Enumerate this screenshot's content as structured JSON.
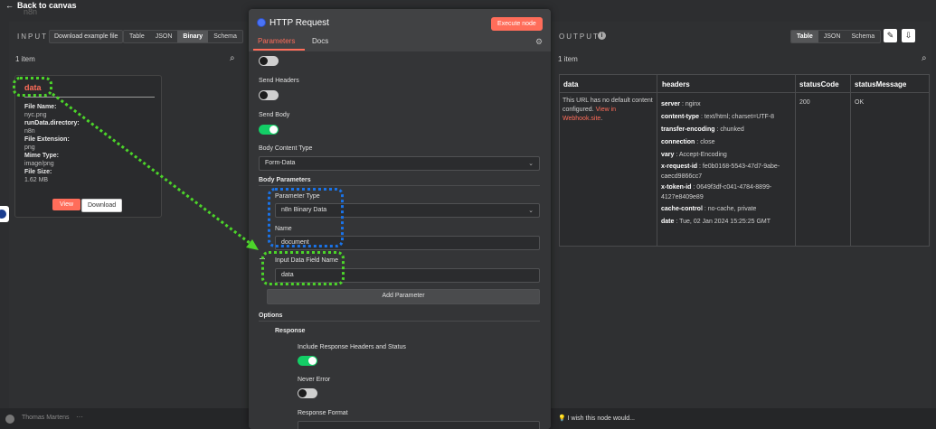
{
  "topbar": {
    "back_label": "Back to canvas",
    "subtitle": "n8n"
  },
  "input_panel": {
    "title": "INPUT",
    "example_button": "Download example file",
    "view_modes": [
      "Table",
      "JSON",
      "Binary",
      "Schema"
    ],
    "active_view": "Binary",
    "item_count": "1 item",
    "binary": {
      "key": "data",
      "fields": [
        {
          "label": "File Name:",
          "value": "nyc.png"
        },
        {
          "label": "runData.directory:",
          "value": "n8n"
        },
        {
          "label": "File Extension:",
          "value": "png"
        },
        {
          "label": "Mime Type:",
          "value": "image/png"
        },
        {
          "label": "File Size:",
          "value": "1.62 MB"
        }
      ],
      "view_button": "View",
      "download_button": "Download"
    }
  },
  "modal": {
    "title": "HTTP Request",
    "execute_button": "Execute node",
    "tabs": [
      "Parameters",
      "Docs"
    ],
    "active_tab": "Parameters",
    "send_headers_label": "Send Headers",
    "send_headers": false,
    "send_body_label": "Send Body",
    "send_body": true,
    "body_content_type_label": "Body Content Type",
    "body_content_type": "Form-Data",
    "body_parameters_label": "Body Parameters",
    "parameter_type_label": "Parameter Type",
    "parameter_type": "n8n Binary Data",
    "name_label": "Name",
    "name_value": "document",
    "input_field_label": "Input Data Field Name",
    "input_field_value": "data",
    "add_parameter": "Add Parameter",
    "options_label": "Options",
    "response_label": "Response",
    "include_headers_label": "Include Response Headers and Status",
    "include_headers": true,
    "never_error_label": "Never Error",
    "never_error": false,
    "response_format_label": "Response Format"
  },
  "output_panel": {
    "title": "OUTPUT",
    "view_modes": [
      "Table",
      "JSON",
      "Schema"
    ],
    "active_view": "Table",
    "item_count": "1 item",
    "columns": [
      "data",
      "headers",
      "statusCode",
      "statusMessage"
    ],
    "data_text": "This URL has no default content configured.",
    "data_link": "View in Webhook.site",
    "data_suffix": ".",
    "headers": [
      {
        "k": "server",
        "v": "nginx"
      },
      {
        "k": "content-type",
        "v": "text/html; charset=UTF-8"
      },
      {
        "k": "transfer-encoding",
        "v": "chunked"
      },
      {
        "k": "connection",
        "v": "close"
      },
      {
        "k": "vary",
        "v": "Accept-Encoding"
      },
      {
        "k": "x-request-id",
        "v": "fe0b0168-5543-47d7-9abe-caecd9866cc7"
      },
      {
        "k": "x-token-id",
        "v": "0649f3df-c041-4784-8899-4127e8409e89"
      },
      {
        "k": "cache-control",
        "v": "no-cache, private"
      },
      {
        "k": "date",
        "v": "Tue, 02 Jan 2024 15:25:25 GMT"
      }
    ],
    "status_code": "200",
    "status_message": "OK"
  },
  "bottom": {
    "user": "Thomas Martens",
    "wish": "I wish this node would..."
  },
  "colors": {
    "accent": "#ff6d5a",
    "toggle_on": "#13ce66",
    "annotation_green": "#4cd42a",
    "annotation_blue": "#1a73e8"
  }
}
